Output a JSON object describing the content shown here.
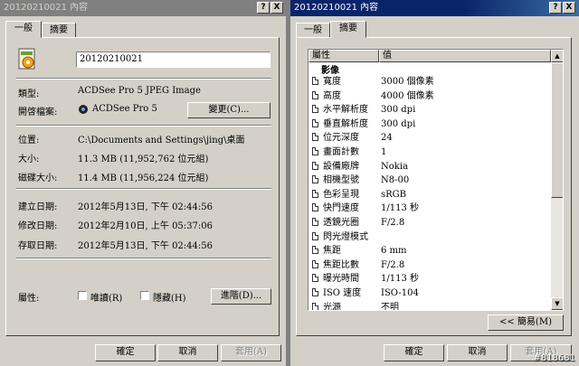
{
  "left": {
    "title": "20120210021 內容",
    "help": "?",
    "close": "X",
    "tabs": [
      "一般",
      "摘要"
    ],
    "filename": "20120210021",
    "props": [
      {
        "label": "類型:",
        "value": "ACDSee Pro 5 JPEG Image"
      },
      {
        "label": "開啓檔案:",
        "value": "ACDSee Pro 5"
      },
      {
        "label": "位置:",
        "value": "C:\\Documents and Settings\\jing\\桌面"
      },
      {
        "label": "大小:",
        "value": "11.3 MB (11,952,762 位元組)"
      },
      {
        "label": "磁碟大小:",
        "value": "11.4 MB (11,956,224 位元組)"
      },
      {
        "label": "建立日期:",
        "value": "2012年5月13日, 下午 02:44:56"
      },
      {
        "label": "修改日期:",
        "value": "2012年2月10日, 上午 05:37:06"
      },
      {
        "label": "存取日期:",
        "value": "2012年5月13日, 下午 02:44:56"
      }
    ],
    "change_button": "變更(C)...",
    "attr_label": "屬性:",
    "readonly": "唯讀(R)",
    "hidden": "隱藏(H)",
    "advanced": "進階(D)...",
    "ok": "確定",
    "cancel": "取消",
    "apply": "套用(A)"
  },
  "right": {
    "title": "20120210021 內容",
    "help": "?",
    "close": "X",
    "tabs": [
      "一般",
      "摘要"
    ],
    "col_property": "屬性",
    "col_value": "值",
    "section": "影像",
    "rows": [
      {
        "name": "寬度",
        "value": "3000 個像素"
      },
      {
        "name": "高度",
        "value": "4000 個像素"
      },
      {
        "name": "水平解析度",
        "value": "300 dpi"
      },
      {
        "name": "垂直解析度",
        "value": "300 dpi"
      },
      {
        "name": "位元深度",
        "value": "24"
      },
      {
        "name": "畫面計數",
        "value": "1"
      },
      {
        "name": "設備廠牌",
        "value": "Nokia"
      },
      {
        "name": "相機型號",
        "value": "N8-00"
      },
      {
        "name": "色彩呈現",
        "value": "sRGB"
      },
      {
        "name": "快門速度",
        "value": "1/113 秒"
      },
      {
        "name": "透鏡光圈",
        "value": "F/2.8"
      },
      {
        "name": "閃光燈模式",
        "value": ""
      },
      {
        "name": "焦距",
        "value": "6 mm"
      },
      {
        "name": "焦距比數",
        "value": "F/2.8"
      },
      {
        "name": "曝光時間",
        "value": "1/113 秒"
      },
      {
        "name": "ISO 速度",
        "value": "ISO-104"
      },
      {
        "name": "光源",
        "value": "不明"
      }
    ],
    "simple_button": "<< 簡易(M)",
    "ok": "確定",
    "cancel": "取消",
    "apply": "套用(A)"
  },
  "watermark": "#818681"
}
